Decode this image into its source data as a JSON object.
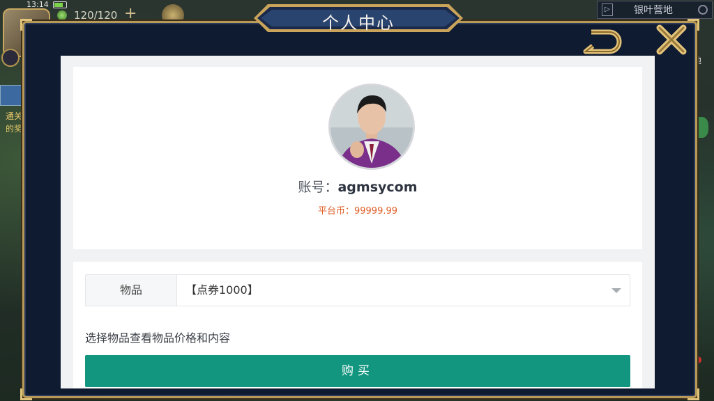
{
  "status_bar": {
    "time": "13:14"
  },
  "hud": {
    "energy": "120/120",
    "location": "银叶营地"
  },
  "side_left": {
    "badge_text": "通关",
    "reward_text": "的奖"
  },
  "side_right": {
    "text": "地"
  },
  "modal": {
    "title": "个人中心"
  },
  "profile": {
    "account_label": "账号：",
    "account_value": "agmsycom",
    "balance": "平台币：99999.99"
  },
  "shop": {
    "item_label": "物品",
    "item_selected": "【点券1000】",
    "hint": "选择物品查看物品价格和内容",
    "buy_label": "购买"
  },
  "colors": {
    "accent_teal": "#13967f",
    "balance_orange": "#e0602a",
    "frame_gold": "#b89a58",
    "modal_navy": "#0f1b30"
  }
}
